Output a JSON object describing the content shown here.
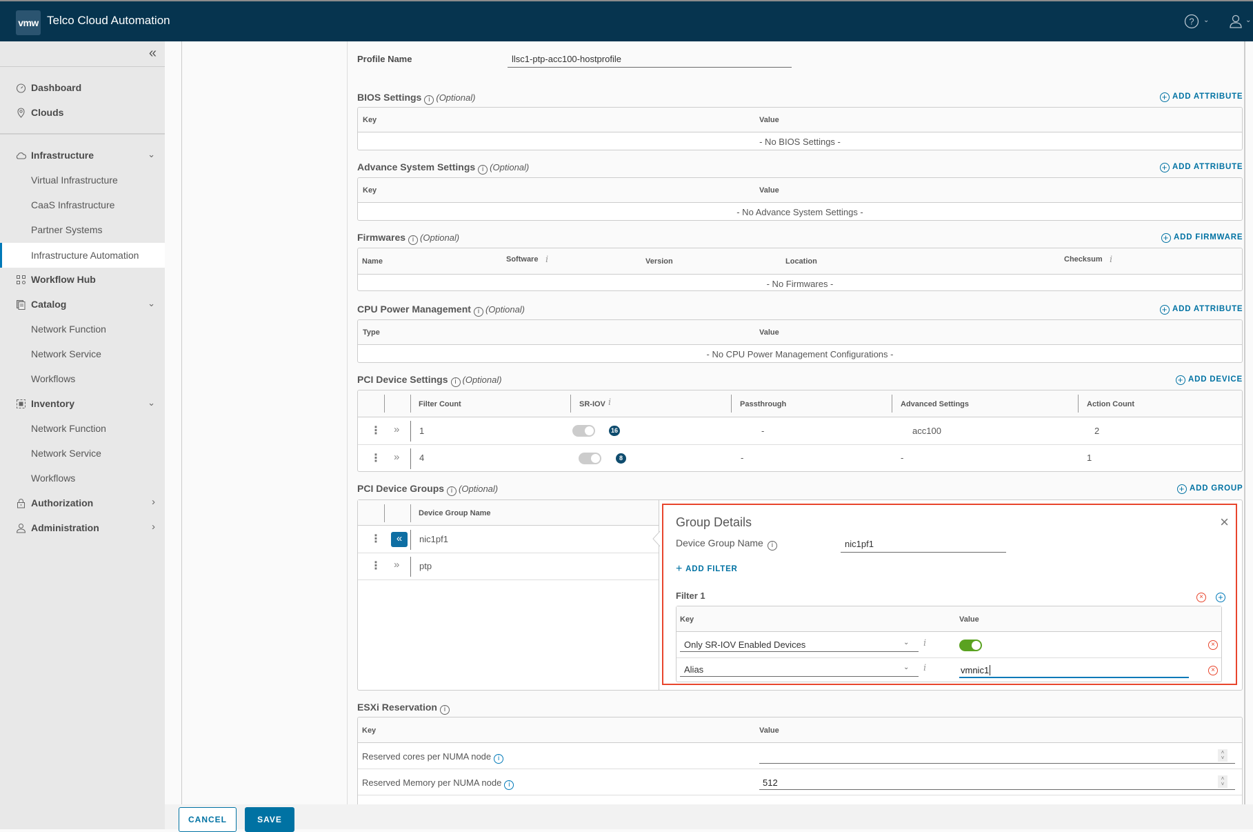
{
  "header": {
    "logo": "vmw",
    "app_title": "Telco Cloud Automation",
    "help_icon": "help-circle-icon",
    "user_icon": "user-icon"
  },
  "sidebar": {
    "collapse_icon": "double-chevron-left-icon",
    "items": [
      {
        "label": "Dashboard",
        "icon": "dashboard-icon",
        "level": "top"
      },
      {
        "label": "Clouds",
        "icon": "map-marker-icon",
        "level": "top"
      },
      {
        "label": "Infrastructure",
        "icon": "cloud-icon",
        "level": "top",
        "expanded": true
      },
      {
        "label": "Virtual Infrastructure",
        "level": "sub"
      },
      {
        "label": "CaaS Infrastructure",
        "level": "sub"
      },
      {
        "label": "Partner Systems",
        "level": "sub"
      },
      {
        "label": "Infrastructure Automation",
        "level": "sub",
        "active": true
      },
      {
        "label": "Workflow Hub",
        "icon": "workflow-hub-icon",
        "level": "top"
      },
      {
        "label": "Catalog",
        "icon": "catalog-icon",
        "level": "top",
        "expanded": true
      },
      {
        "label": "Network Function",
        "level": "sub"
      },
      {
        "label": "Network Service",
        "level": "sub"
      },
      {
        "label": "Workflows",
        "level": "sub"
      },
      {
        "label": "Inventory",
        "icon": "inventory-icon",
        "level": "top",
        "expanded": true
      },
      {
        "label": "Network Function",
        "level": "sub"
      },
      {
        "label": "Network Service",
        "level": "sub"
      },
      {
        "label": "Workflows",
        "level": "sub"
      },
      {
        "label": "Authorization",
        "icon": "lock-icon",
        "level": "top",
        "expanded": false
      },
      {
        "label": "Administration",
        "icon": "user-icon",
        "level": "top",
        "expanded": false
      }
    ]
  },
  "form": {
    "profile_name_label": "Profile Name",
    "profile_name_value": "llsc1-ptp-acc100-hostprofile",
    "optional_label": "(Optional)",
    "bios": {
      "title": "BIOS Settings",
      "add_label": "ADD ATTRIBUTE",
      "columns": [
        "Key",
        "Value"
      ],
      "empty": "- No BIOS Settings -"
    },
    "advance_system": {
      "title": "Advance System Settings",
      "add_label": "ADD ATTRIBUTE",
      "columns": [
        "Key",
        "Value"
      ],
      "empty": "- No Advance System Settings -"
    },
    "firmwares": {
      "title": "Firmwares",
      "add_label": "ADD FIRMWARE",
      "columns": [
        "Name",
        "Software",
        "Version",
        "Location",
        "Checksum"
      ],
      "empty": "- No Firmwares -"
    },
    "cpu_power": {
      "title": "CPU Power Management",
      "add_label": "ADD ATTRIBUTE",
      "columns": [
        "Type",
        "Value"
      ],
      "empty": "- No CPU Power Management Configurations -"
    },
    "pci_device_settings": {
      "title": "PCI Device Settings",
      "add_label": "ADD DEVICE",
      "columns": [
        "Filter Count",
        "SR-IOV",
        "Passthrough",
        "Advanced Settings",
        "Action Count"
      ],
      "rows": [
        {
          "filter_count": "1",
          "sriov_enabled": false,
          "sriov_badge": "16",
          "passthrough": "-",
          "advanced_settings": "acc100",
          "action_count": "2"
        },
        {
          "filter_count": "4",
          "sriov_enabled": false,
          "sriov_badge": "8",
          "passthrough": "-",
          "advanced_settings": "-",
          "action_count": "1"
        }
      ]
    },
    "pci_device_groups": {
      "title": "PCI Device Groups",
      "add_label": "ADD GROUP",
      "columns": [
        "Device Group Name"
      ],
      "rows": [
        {
          "name": "nic1pf1",
          "selected": true
        },
        {
          "name": "ptp",
          "selected": false
        }
      ],
      "details": {
        "title": "Group Details",
        "device_group_name_label": "Device Group Name",
        "device_group_name_value": "nic1pf1",
        "add_filter_label": "ADD FILTER",
        "filter_title": "Filter 1",
        "columns": [
          "Key",
          "Value"
        ],
        "filters": [
          {
            "key": "Only SR-IOV Enabled Devices",
            "value_type": "toggle",
            "value": true
          },
          {
            "key": "Alias",
            "value_type": "text",
            "value": "vmnic1"
          }
        ]
      }
    },
    "esxi_reservation": {
      "title": "ESXi Reservation",
      "columns": [
        "Key",
        "Value"
      ],
      "rows": [
        {
          "key": "Reserved cores per NUMA node",
          "value": ""
        },
        {
          "key": "Reserved Memory per NUMA node",
          "value": "512"
        }
      ]
    }
  },
  "footer": {
    "cancel_label": "CANCEL",
    "save_label": "SAVE"
  }
}
